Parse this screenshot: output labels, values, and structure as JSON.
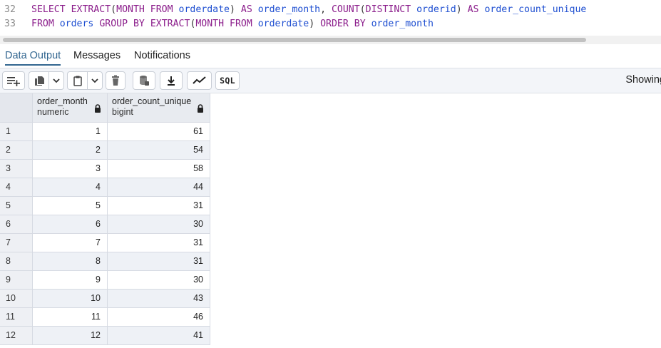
{
  "editor": {
    "lines": [
      {
        "number": "32",
        "tokens": [
          {
            "t": "SELECT",
            "c": "kw"
          },
          {
            "t": " ",
            "c": "sp"
          },
          {
            "t": "EXTRACT",
            "c": "kw"
          },
          {
            "t": "(",
            "c": "pu"
          },
          {
            "t": "MONTH",
            "c": "kw"
          },
          {
            "t": " ",
            "c": "sp"
          },
          {
            "t": "FROM",
            "c": "kw"
          },
          {
            "t": " ",
            "c": "sp"
          },
          {
            "t": "orderdate",
            "c": "id"
          },
          {
            "t": ")",
            "c": "pu"
          },
          {
            "t": " ",
            "c": "sp"
          },
          {
            "t": "AS",
            "c": "kw"
          },
          {
            "t": " ",
            "c": "sp"
          },
          {
            "t": "order_month",
            "c": "id"
          },
          {
            "t": ",",
            "c": "pu"
          },
          {
            "t": " ",
            "c": "sp"
          },
          {
            "t": "COUNT",
            "c": "kw"
          },
          {
            "t": "(",
            "c": "pu"
          },
          {
            "t": "DISTINCT",
            "c": "kw"
          },
          {
            "t": " ",
            "c": "sp"
          },
          {
            "t": "orderid",
            "c": "id"
          },
          {
            "t": ")",
            "c": "pu"
          },
          {
            "t": " ",
            "c": "sp"
          },
          {
            "t": "AS",
            "c": "kw"
          },
          {
            "t": " ",
            "c": "sp"
          },
          {
            "t": "order_count_unique",
            "c": "id"
          }
        ]
      },
      {
        "number": "33",
        "tokens": [
          {
            "t": "FROM",
            "c": "kw"
          },
          {
            "t": " ",
            "c": "sp"
          },
          {
            "t": "orders",
            "c": "id"
          },
          {
            "t": " ",
            "c": "sp"
          },
          {
            "t": "GROUP",
            "c": "kw"
          },
          {
            "t": " ",
            "c": "sp"
          },
          {
            "t": "BY",
            "c": "kw"
          },
          {
            "t": " ",
            "c": "sp"
          },
          {
            "t": "EXTRACT",
            "c": "kw"
          },
          {
            "t": "(",
            "c": "pu"
          },
          {
            "t": "MONTH",
            "c": "kw"
          },
          {
            "t": " ",
            "c": "sp"
          },
          {
            "t": "FROM",
            "c": "kw"
          },
          {
            "t": " ",
            "c": "sp"
          },
          {
            "t": "orderdate",
            "c": "id"
          },
          {
            "t": ")",
            "c": "pu"
          },
          {
            "t": " ",
            "c": "sp"
          },
          {
            "t": "ORDER",
            "c": "kw"
          },
          {
            "t": " ",
            "c": "sp"
          },
          {
            "t": "BY",
            "c": "kw"
          },
          {
            "t": " ",
            "c": "sp"
          },
          {
            "t": "order_month",
            "c": "id"
          }
        ]
      }
    ]
  },
  "tabs": [
    {
      "label": "Data Output",
      "active": true
    },
    {
      "label": "Messages",
      "active": false
    },
    {
      "label": "Notifications",
      "active": false
    }
  ],
  "toolbar": {
    "icons": [
      "add-row-icon",
      "copy-icon",
      "chevron-down-icon",
      "paste-icon",
      "chevron-down-icon",
      "delete-icon",
      "save-data-icon",
      "download-icon",
      "graph-icon"
    ],
    "sql_label": "SQL",
    "status_text": "Showing"
  },
  "grid": {
    "columns": [
      {
        "name": "order_month",
        "type": "numeric"
      },
      {
        "name": "order_count_unique",
        "type": "bigint"
      }
    ],
    "rows": [
      {
        "n": "1",
        "values": [
          "1",
          "61"
        ]
      },
      {
        "n": "2",
        "values": [
          "2",
          "54"
        ]
      },
      {
        "n": "3",
        "values": [
          "3",
          "58"
        ]
      },
      {
        "n": "4",
        "values": [
          "4",
          "44"
        ]
      },
      {
        "n": "5",
        "values": [
          "5",
          "31"
        ]
      },
      {
        "n": "6",
        "values": [
          "6",
          "30"
        ]
      },
      {
        "n": "7",
        "values": [
          "7",
          "31"
        ]
      },
      {
        "n": "8",
        "values": [
          "8",
          "31"
        ]
      },
      {
        "n": "9",
        "values": [
          "9",
          "30"
        ]
      },
      {
        "n": "10",
        "values": [
          "10",
          "43"
        ]
      },
      {
        "n": "11",
        "values": [
          "11",
          "46"
        ]
      },
      {
        "n": "12",
        "values": [
          "12",
          "41"
        ]
      }
    ]
  },
  "colors": {
    "keyword": "#8b1d8b",
    "identifier": "#1f4fd1",
    "active_tab": "#326690"
  }
}
